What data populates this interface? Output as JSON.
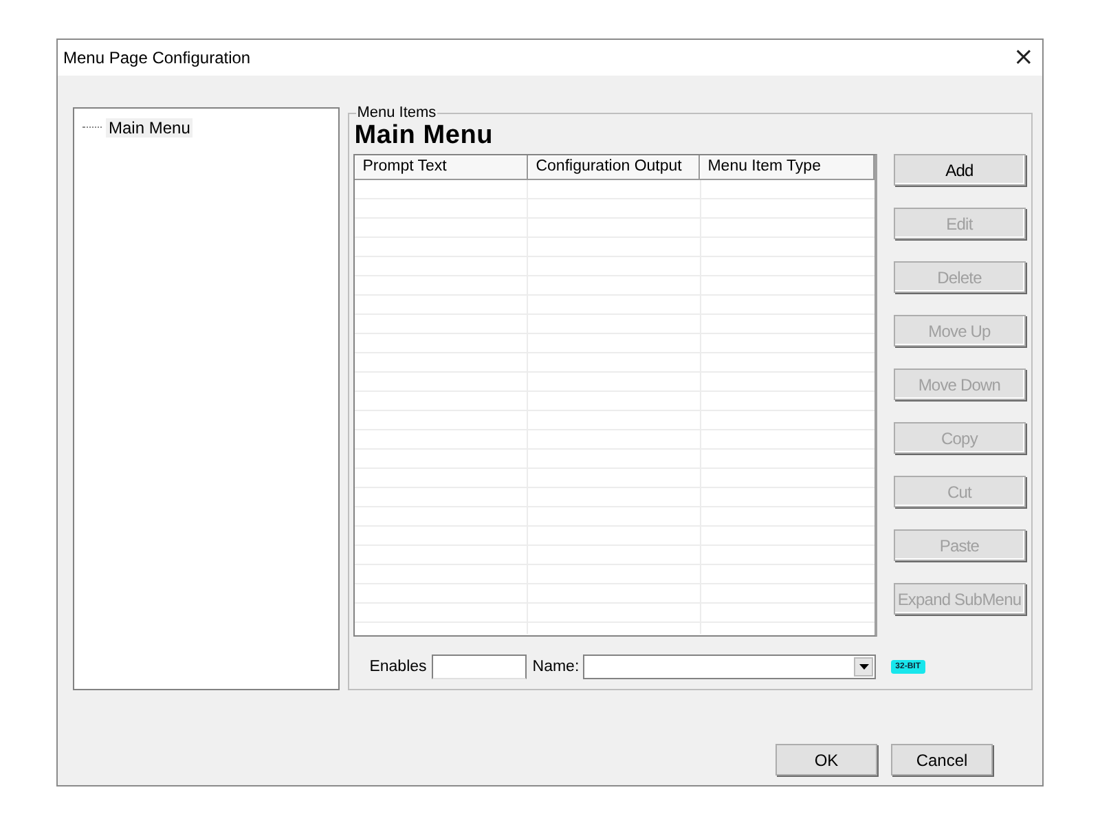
{
  "window": {
    "title": "Menu Page Configuration",
    "close": "×"
  },
  "tree": {
    "items": [
      {
        "label": "Main Menu",
        "selected": true
      }
    ]
  },
  "group": {
    "label": "Menu Items",
    "heading": "Main Menu"
  },
  "table": {
    "columns": [
      "Prompt Text",
      "Configuration Output",
      "Menu Item Type"
    ]
  },
  "buttons": [
    {
      "label": "Add",
      "disabled": false
    },
    {
      "label": "Edit",
      "disabled": true
    },
    {
      "label": "Delete",
      "disabled": true
    },
    {
      "label": "Move Up",
      "disabled": true
    },
    {
      "label": "Move Down",
      "disabled": true
    },
    {
      "label": "Copy",
      "disabled": true
    },
    {
      "label": "Cut",
      "disabled": true
    },
    {
      "label": "Paste",
      "disabled": true
    },
    {
      "label": "Expand SubMenu",
      "disabled": true
    }
  ],
  "fields": {
    "enables_label": "Enables",
    "name_label": "Name:",
    "badge": "32-BIT"
  },
  "footer": [
    "OK",
    "Cancel"
  ]
}
